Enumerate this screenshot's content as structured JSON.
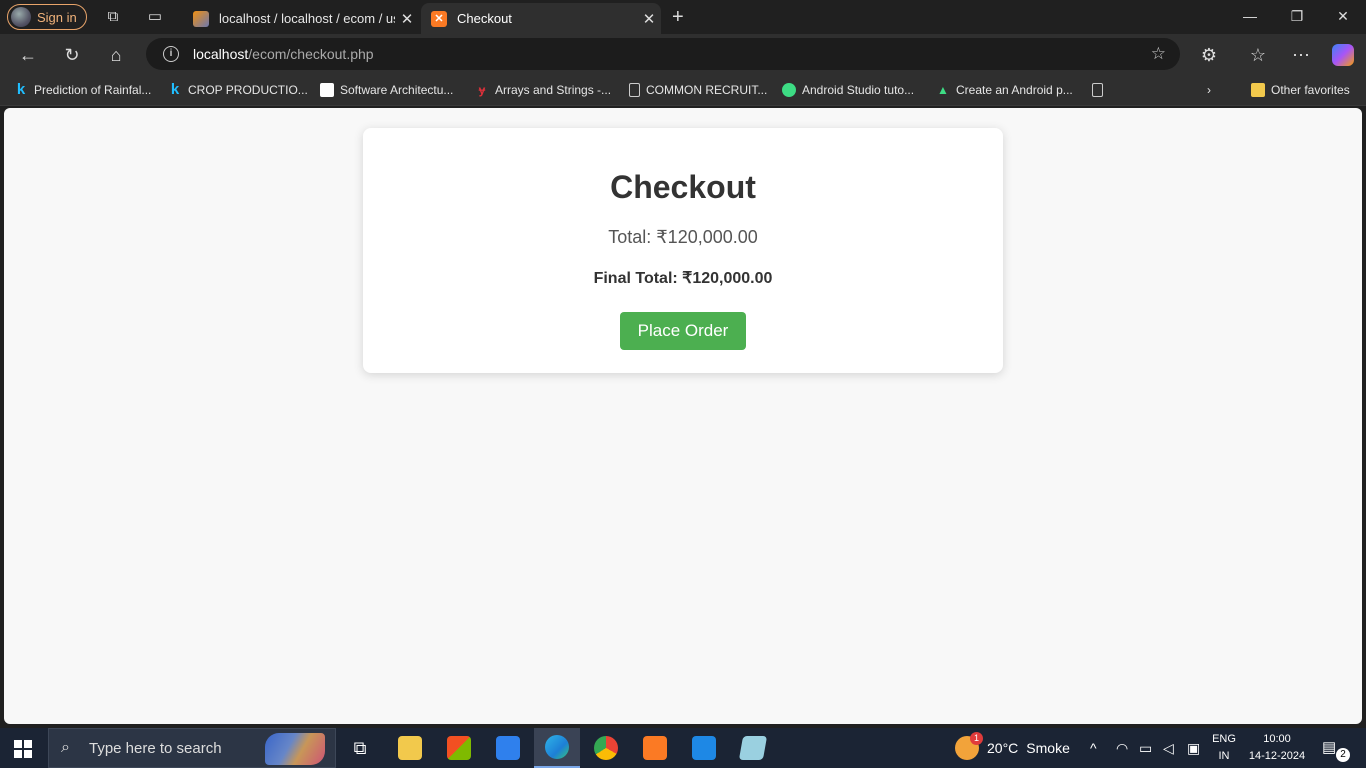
{
  "browser": {
    "sign_in_label": "Sign in",
    "tabs": [
      {
        "title": "localhost / localhost / ecom / users",
        "active": false
      },
      {
        "title": "Checkout",
        "active": true
      }
    ],
    "address": {
      "host": "localhost",
      "path": "/ecom/checkout.php"
    },
    "favorites": [
      {
        "label": "Prediction of Rainfal...",
        "icon": "kaggle-icon"
      },
      {
        "label": "CROP PRODUCTIO...",
        "icon": "kaggle-icon"
      },
      {
        "label": "Software Architectu...",
        "icon": "site-icon"
      },
      {
        "label": "Arrays and Strings -...",
        "icon": "site-icon"
      },
      {
        "label": "COMMON RECRUIT...",
        "icon": "page-icon"
      },
      {
        "label": "Android Studio tuto...",
        "icon": "android-icon"
      },
      {
        "label": "Create an Android p...",
        "icon": "android-icon"
      }
    ],
    "other_favorites_label": "Other favorites"
  },
  "page": {
    "heading": "Checkout",
    "total": "Total: ₹120,000.00",
    "final_total": "Final Total: ₹120,000.00",
    "place_order_label": "Place Order",
    "colors": {
      "button": "#4caf50",
      "background": "#f8f8f8",
      "card": "#ffffff"
    }
  },
  "taskbar": {
    "search_placeholder": "Type here to search",
    "weather": {
      "temp": "20°C",
      "condition": "Smoke",
      "badge": "1"
    },
    "language": {
      "line1": "ENG",
      "line2": "IN"
    },
    "clock": {
      "time": "10:00",
      "date": "14-12-2024"
    },
    "notifications": "2"
  }
}
